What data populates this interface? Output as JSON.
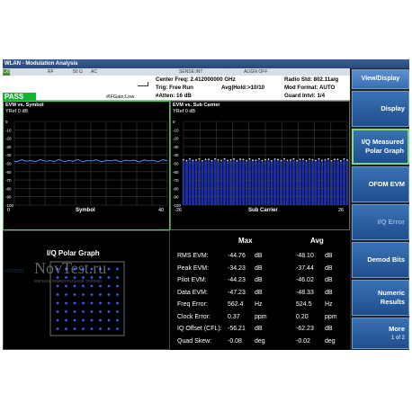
{
  "window": {
    "title": "WLAN - Modulation Analysis"
  },
  "statusbar": {
    "lxi": "LXI",
    "input": "RF",
    "impedance": "50 Ω",
    "coupling": "AC",
    "sense": "SENSE:INT",
    "align": "ALIGN OFF"
  },
  "info": {
    "center_freq": "Center Freq: 2.412000000 GHz",
    "trig": "Trig: Free Run",
    "avg_hold": "Avg|Hold:>10/10",
    "atten": "#Atten: 16 dB",
    "radio_std": "Radio Std: 802.11a/g",
    "mod_format": "Mod Format: AUTO",
    "guard_intvl": "Guard Intvl: 1/4",
    "if_gain": "#IFGain:Low",
    "pass": "PASS"
  },
  "evm_symbol": {
    "title": "EVM vs. Symbol",
    "yref": "YRef 0 dB",
    "ticks": [
      "0",
      "-10",
      "-20",
      "-30",
      "-40",
      "-50",
      "-60",
      "-70",
      "-80",
      "-90",
      "-100"
    ],
    "x_left": "0",
    "x_right": "40",
    "x_label": "Symbol"
  },
  "evm_carrier": {
    "title": "EVM vs. Sub Carrier",
    "yref": "YRef 0 dB",
    "ticks": [
      "0",
      "-10",
      "-20",
      "-30",
      "-40",
      "-50",
      "-60",
      "-70",
      "-80",
      "-90",
      "-100"
    ],
    "x_left": "-26",
    "x_right": "26",
    "x_label": "Sub Carrier"
  },
  "iq_polar": {
    "title": "I/Q Polar Graph"
  },
  "results": {
    "col_max": "Max",
    "col_avg": "Avg",
    "rows": [
      {
        "label": "RMS EVM:",
        "max": "-44.76",
        "max_unit": "dB",
        "avg": "-48.10",
        "avg_unit": "dB"
      },
      {
        "label": "Peak EVM:",
        "max": "-34.23",
        "max_unit": "dB",
        "avg": "-37.44",
        "avg_unit": "dB"
      },
      {
        "label": "Pilot EVM:",
        "max": "-44.23",
        "max_unit": "dB",
        "avg": "-46.02",
        "avg_unit": "dB"
      },
      {
        "label": "Data EVM:",
        "max": "-47.23",
        "max_unit": "dB",
        "avg": "-48.33",
        "avg_unit": "dB"
      },
      {
        "label": "Freq Error:",
        "max": "562.4",
        "max_unit": "Hz",
        "avg": "524.5",
        "avg_unit": "Hz"
      },
      {
        "label": "Clock Error:",
        "max": "0.37",
        "max_unit": "ppm",
        "avg": "0.20",
        "avg_unit": "ppm"
      },
      {
        "label": "IQ Offset (CFL):",
        "max": "-56.21",
        "max_unit": "dB",
        "avg": "-62.23",
        "avg_unit": "dB"
      },
      {
        "label": "Quad Skew:",
        "max": "-0.08",
        "max_unit": "deg",
        "avg": "-0.02",
        "avg_unit": "deg"
      }
    ]
  },
  "softkeys": {
    "header": "View/Display",
    "display": "Display",
    "iq_measured_1": "I/Q Measured",
    "iq_measured_2": "Polar Graph",
    "ofdm_evm": "OFDM EVM",
    "iq_error": "I/Q Error",
    "demod_bits": "Demod Bits",
    "numeric_1": "Numeric",
    "numeric_2": "Results",
    "more": "More",
    "more_page": "1 of 2"
  },
  "watermark": {
    "text": "NovTest.ru",
    "subtext": "магазин измерительной техники",
    "logo": "novtest"
  },
  "colors": {
    "trace": "#4f8bff",
    "bars": "#1d2fa8",
    "pilot": "#ffe24a",
    "pass": "#13b339",
    "active_frame": "#7ed67e"
  }
}
